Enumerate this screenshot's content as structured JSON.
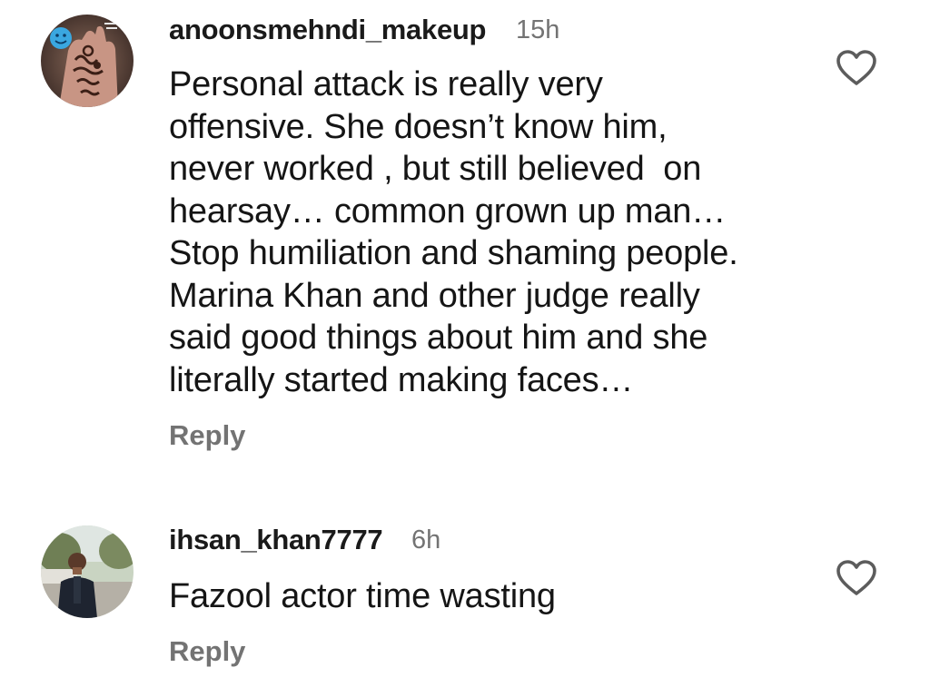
{
  "comments": [
    {
      "username": "anoonsmehndi_makeup",
      "time": "15h",
      "lines": [
        "Personal attack is really very",
        "offensive. She doesn’t know him,",
        "never worked , but still believed  on",
        "hearsay… common grown up man…",
        "Stop humiliation and shaming people.",
        "Marina Khan and other judge really",
        "said good things about him and she",
        "literally started making faces…"
      ],
      "reply_label": "Reply",
      "like_icon": "heart-outline-icon",
      "avatar_icon": "henna-hand-avatar"
    },
    {
      "username": "ihsan_khan7777",
      "time": "6h",
      "lines": [
        "Fazool actor time wasting"
      ],
      "reply_label": "Reply",
      "like_icon": "heart-outline-icon",
      "avatar_icon": "man-outdoors-avatar"
    }
  ],
  "colors": {
    "text": "#151515",
    "secondary": "#737373",
    "background": "#ffffff"
  }
}
